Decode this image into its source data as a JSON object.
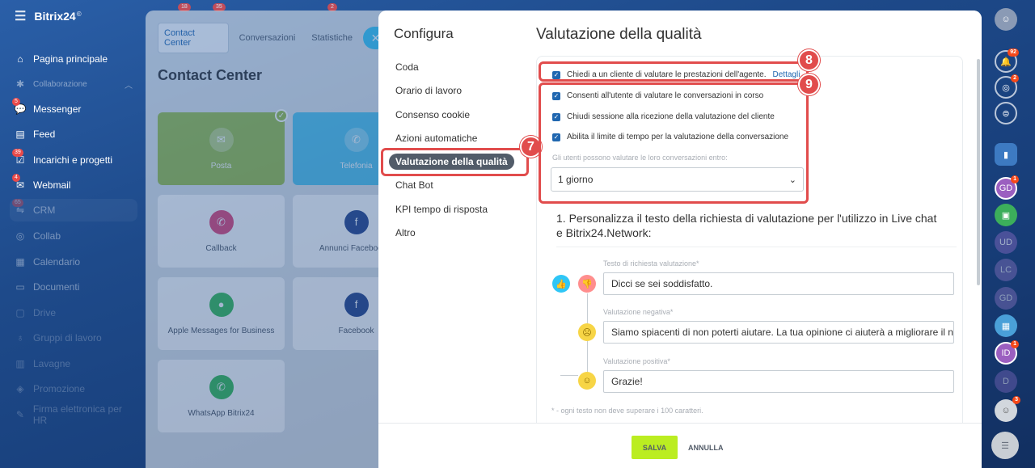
{
  "app": {
    "brand": "Bitrix24",
    "brand_mark": "©"
  },
  "sidebar": {
    "items": [
      {
        "label": "Pagina principale",
        "icon": "home-icon"
      },
      {
        "label": "Collaborazione",
        "icon": "collab-icon"
      },
      {
        "label": "Messenger",
        "icon": "chat-icon",
        "count": "5"
      },
      {
        "label": "Feed",
        "icon": "feed-icon"
      },
      {
        "label": "Incarichi e progetti",
        "icon": "tasks-icon",
        "count": "39"
      },
      {
        "label": "Webmail",
        "icon": "mail-icon",
        "count": "4"
      },
      {
        "label": "CRM",
        "icon": "crm-icon",
        "count": "65"
      },
      {
        "label": "Collab",
        "icon": "collab-circle-icon"
      },
      {
        "label": "Calendario",
        "icon": "calendar-icon"
      },
      {
        "label": "Documenti",
        "icon": "docs-icon"
      },
      {
        "label": "Drive",
        "icon": "drive-icon"
      },
      {
        "label": "Gruppi di lavoro",
        "icon": "groups-icon"
      },
      {
        "label": "Lavagne",
        "icon": "boards-icon"
      },
      {
        "label": "Promozione",
        "icon": "promo-icon"
      },
      {
        "label": "Firma elettronica per HR",
        "icon": "sign-icon"
      }
    ],
    "top_badges": [
      "18",
      "35",
      "2"
    ]
  },
  "background_panel": {
    "tabs": [
      "Contact Center",
      "Conversazioni",
      "Statistiche"
    ],
    "close": "✕",
    "title": "Contact Center",
    "tiles": [
      {
        "label": "Posta"
      },
      {
        "label": "Telefonia"
      },
      {
        "label": "Callback"
      },
      {
        "label": "Annunci Facebook p"
      },
      {
        "label": "Apple Messages for Business"
      },
      {
        "label": "Facebook"
      },
      {
        "label": "WhatsApp Bitrix24"
      }
    ]
  },
  "config": {
    "title": "Configura",
    "nav": [
      {
        "label": "Coda"
      },
      {
        "label": "Orario di lavoro"
      },
      {
        "label": "Consenso cookie"
      },
      {
        "label": "Azioni automatiche"
      },
      {
        "label": "Valutazione della qualità",
        "active": true
      },
      {
        "label": "Chat Bot"
      },
      {
        "label": "KPI tempo di risposta"
      },
      {
        "label": "Altro"
      }
    ]
  },
  "main": {
    "title": "Valutazione della qualità",
    "checkbox_agent": {
      "label": "Chiedi a un cliente di valutare le prestazioni dell'agente.",
      "link": "Dettagli",
      "checked": true
    },
    "checkbox_ongoing": {
      "label": "Consenti all'utente di valutare le conversazioni in corso",
      "checked": true
    },
    "checkbox_close": {
      "label": "Chiudi sessione alla ricezione della valutazione del cliente",
      "checked": true
    },
    "checkbox_limit": {
      "label": "Abilita il limite di tempo per la valutazione della conversazione",
      "checked": true
    },
    "time_limit": {
      "label": "Gli utenti possono valutare le loro conversazioni entro:",
      "value": "1 giorno"
    },
    "section_title": "1. Personalizza il testo della richiesta di valutazione per l'utilizzo in Live chat e Bitrix24.Network:",
    "request": {
      "label": "Testo di richiesta valutazione*",
      "value": "Dicci se sei soddisfatto."
    },
    "negative": {
      "label": "Valutazione negativa*",
      "value": "Siamo spiacenti di non poterti aiutare. La tua opinione ci aiuterà a migliorare il no..."
    },
    "positive": {
      "label": "Valutazione positiva*",
      "value": "Grazie!"
    },
    "note": "* - ogni testo non deve superare i 100 caratteri."
  },
  "footer": {
    "save": "SALVA",
    "cancel": "ANNULLA"
  },
  "annotations": {
    "step7": "7",
    "step8": "8",
    "step9": "9",
    "color": "#e14c4c"
  },
  "right_bar": {
    "badges": {
      "notifications": "92",
      "activity": "2",
      "user_gd": "1",
      "user_id": "1",
      "avatar": "3"
    },
    "initials": [
      "GD",
      "UD",
      "LC",
      "GD",
      "ID",
      "D"
    ]
  }
}
